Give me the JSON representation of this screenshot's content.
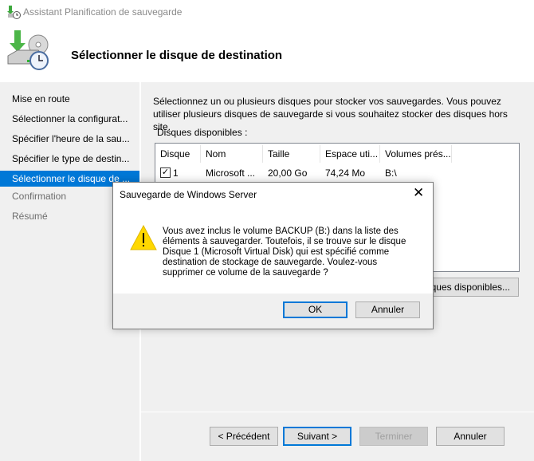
{
  "window": {
    "title": "Assistant Planification de sauvegarde",
    "icon": "backup-schedule-icon"
  },
  "header": {
    "title": "Sélectionner le disque de destination",
    "icon": "backup-disk-clock-icon"
  },
  "sidebar": {
    "items": [
      {
        "label": "Mise en route",
        "state": "normal"
      },
      {
        "label": "Sélectionner la configurat...",
        "state": "normal"
      },
      {
        "label": "Spécifier l'heure de la sau...",
        "state": "normal"
      },
      {
        "label": "Spécifier le type de destin...",
        "state": "normal"
      },
      {
        "label": "Sélectionner le disque de ...",
        "state": "selected"
      },
      {
        "label": "Confirmation",
        "state": "disabled"
      },
      {
        "label": "Résumé",
        "state": "disabled"
      }
    ]
  },
  "main": {
    "intro": "Sélectionnez un ou plusieurs disques pour stocker vos sauvegardes. Vous pouvez utiliser plusieurs disques de sauvegarde si vous souhaitez stocker des disques hors site.",
    "disks_label": "Disques disponibles :",
    "columns": [
      "Disque",
      "Nom",
      "Taille",
      "Espace uti...",
      "Volumes prés..."
    ],
    "rows": [
      {
        "checked": true,
        "disk": "1",
        "name": "Microsoft ...",
        "size": "20,00 Go",
        "used": "74,24 Mo",
        "volumes": "B:\\"
      }
    ],
    "show_all_button": "ques disponibles..."
  },
  "footer": {
    "prev": "< Précédent",
    "next": "Suivant >",
    "finish": "Terminer",
    "cancel": "Annuler"
  },
  "dialog": {
    "title": "Sauvegarde de Windows Server",
    "icon": "warning-icon",
    "message": [
      "Vous avez inclus le volume BACKUP (B:) dans la liste des",
      "éléments à sauvegarder. Toutefois, il se trouve sur le disque",
      "Disque 1 (Microsoft Virtual Disk) qui est spécifié comme",
      "destination de stockage de sauvegarde. Voulez-vous",
      "supprimer ce volume de la sauvegarde ?"
    ],
    "ok": "OK",
    "cancel": "Annuler"
  },
  "colors": {
    "accent": "#0078d7",
    "warning": "#ffd800"
  }
}
